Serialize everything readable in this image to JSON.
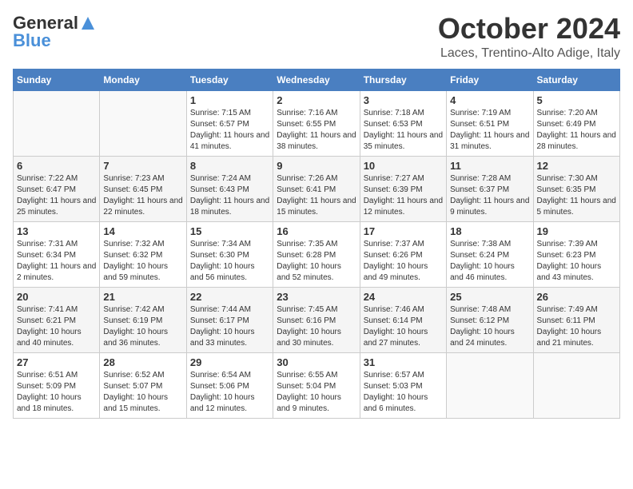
{
  "header": {
    "logo_general": "General",
    "logo_blue": "Blue",
    "month": "October 2024",
    "location": "Laces, Trentino-Alto Adige, Italy"
  },
  "calendar": {
    "days_of_week": [
      "Sunday",
      "Monday",
      "Tuesday",
      "Wednesday",
      "Thursday",
      "Friday",
      "Saturday"
    ],
    "weeks": [
      [
        {
          "day": "",
          "info": ""
        },
        {
          "day": "",
          "info": ""
        },
        {
          "day": "1",
          "info": "Sunrise: 7:15 AM\nSunset: 6:57 PM\nDaylight: 11 hours and 41 minutes."
        },
        {
          "day": "2",
          "info": "Sunrise: 7:16 AM\nSunset: 6:55 PM\nDaylight: 11 hours and 38 minutes."
        },
        {
          "day": "3",
          "info": "Sunrise: 7:18 AM\nSunset: 6:53 PM\nDaylight: 11 hours and 35 minutes."
        },
        {
          "day": "4",
          "info": "Sunrise: 7:19 AM\nSunset: 6:51 PM\nDaylight: 11 hours and 31 minutes."
        },
        {
          "day": "5",
          "info": "Sunrise: 7:20 AM\nSunset: 6:49 PM\nDaylight: 11 hours and 28 minutes."
        }
      ],
      [
        {
          "day": "6",
          "info": "Sunrise: 7:22 AM\nSunset: 6:47 PM\nDaylight: 11 hours and 25 minutes."
        },
        {
          "day": "7",
          "info": "Sunrise: 7:23 AM\nSunset: 6:45 PM\nDaylight: 11 hours and 22 minutes."
        },
        {
          "day": "8",
          "info": "Sunrise: 7:24 AM\nSunset: 6:43 PM\nDaylight: 11 hours and 18 minutes."
        },
        {
          "day": "9",
          "info": "Sunrise: 7:26 AM\nSunset: 6:41 PM\nDaylight: 11 hours and 15 minutes."
        },
        {
          "day": "10",
          "info": "Sunrise: 7:27 AM\nSunset: 6:39 PM\nDaylight: 11 hours and 12 minutes."
        },
        {
          "day": "11",
          "info": "Sunrise: 7:28 AM\nSunset: 6:37 PM\nDaylight: 11 hours and 9 minutes."
        },
        {
          "day": "12",
          "info": "Sunrise: 7:30 AM\nSunset: 6:35 PM\nDaylight: 11 hours and 5 minutes."
        }
      ],
      [
        {
          "day": "13",
          "info": "Sunrise: 7:31 AM\nSunset: 6:34 PM\nDaylight: 11 hours and 2 minutes."
        },
        {
          "day": "14",
          "info": "Sunrise: 7:32 AM\nSunset: 6:32 PM\nDaylight: 10 hours and 59 minutes."
        },
        {
          "day": "15",
          "info": "Sunrise: 7:34 AM\nSunset: 6:30 PM\nDaylight: 10 hours and 56 minutes."
        },
        {
          "day": "16",
          "info": "Sunrise: 7:35 AM\nSunset: 6:28 PM\nDaylight: 10 hours and 52 minutes."
        },
        {
          "day": "17",
          "info": "Sunrise: 7:37 AM\nSunset: 6:26 PM\nDaylight: 10 hours and 49 minutes."
        },
        {
          "day": "18",
          "info": "Sunrise: 7:38 AM\nSunset: 6:24 PM\nDaylight: 10 hours and 46 minutes."
        },
        {
          "day": "19",
          "info": "Sunrise: 7:39 AM\nSunset: 6:23 PM\nDaylight: 10 hours and 43 minutes."
        }
      ],
      [
        {
          "day": "20",
          "info": "Sunrise: 7:41 AM\nSunset: 6:21 PM\nDaylight: 10 hours and 40 minutes."
        },
        {
          "day": "21",
          "info": "Sunrise: 7:42 AM\nSunset: 6:19 PM\nDaylight: 10 hours and 36 minutes."
        },
        {
          "day": "22",
          "info": "Sunrise: 7:44 AM\nSunset: 6:17 PM\nDaylight: 10 hours and 33 minutes."
        },
        {
          "day": "23",
          "info": "Sunrise: 7:45 AM\nSunset: 6:16 PM\nDaylight: 10 hours and 30 minutes."
        },
        {
          "day": "24",
          "info": "Sunrise: 7:46 AM\nSunset: 6:14 PM\nDaylight: 10 hours and 27 minutes."
        },
        {
          "day": "25",
          "info": "Sunrise: 7:48 AM\nSunset: 6:12 PM\nDaylight: 10 hours and 24 minutes."
        },
        {
          "day": "26",
          "info": "Sunrise: 7:49 AM\nSunset: 6:11 PM\nDaylight: 10 hours and 21 minutes."
        }
      ],
      [
        {
          "day": "27",
          "info": "Sunrise: 6:51 AM\nSunset: 5:09 PM\nDaylight: 10 hours and 18 minutes."
        },
        {
          "day": "28",
          "info": "Sunrise: 6:52 AM\nSunset: 5:07 PM\nDaylight: 10 hours and 15 minutes."
        },
        {
          "day": "29",
          "info": "Sunrise: 6:54 AM\nSunset: 5:06 PM\nDaylight: 10 hours and 12 minutes."
        },
        {
          "day": "30",
          "info": "Sunrise: 6:55 AM\nSunset: 5:04 PM\nDaylight: 10 hours and 9 minutes."
        },
        {
          "day": "31",
          "info": "Sunrise: 6:57 AM\nSunset: 5:03 PM\nDaylight: 10 hours and 6 minutes."
        },
        {
          "day": "",
          "info": ""
        },
        {
          "day": "",
          "info": ""
        }
      ]
    ]
  }
}
